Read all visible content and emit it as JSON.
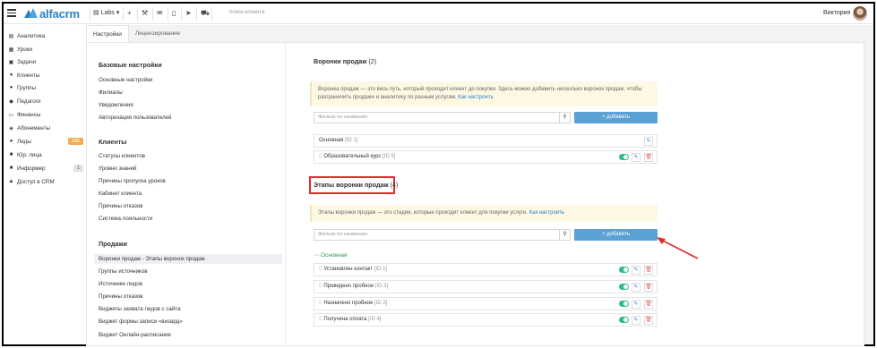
{
  "topbar": {
    "menu_icon": "hamburger-icon",
    "logo_text": "alfacrm",
    "workspace": "Labs",
    "workspace_icon": "building-icon",
    "icons": [
      "plus-icon",
      "wrench-icon",
      "mail-icon",
      "mobile-icon",
      "send-icon",
      "cart-icon"
    ],
    "search_placeholder": "поиск клиента",
    "user_name": "Виктория"
  },
  "sidebar": {
    "items": [
      {
        "label": "Аналитика",
        "icon": "chart-icon"
      },
      {
        "label": "Уроки",
        "icon": "calendar-icon"
      },
      {
        "label": "Задачи",
        "icon": "tasks-icon"
      },
      {
        "label": "Клиенты",
        "icon": "user-icon"
      },
      {
        "label": "Группы",
        "icon": "users-icon"
      },
      {
        "label": "Педагоги",
        "icon": "graduation-cap-icon"
      },
      {
        "label": "Финансы",
        "icon": "money-icon"
      },
      {
        "label": "Абонементы",
        "icon": "tag-icon"
      },
      {
        "label": "Лиды",
        "icon": "user-plus-icon",
        "badge": "335"
      },
      {
        "label": "Юр. лица",
        "icon": "briefcase-icon"
      },
      {
        "label": "Информер",
        "icon": "bell-icon",
        "badge": "1"
      },
      {
        "label": "Доступ в CRM",
        "icon": "lock-icon"
      }
    ]
  },
  "tabs": [
    {
      "label": "Настройки",
      "active": true
    },
    {
      "label": "Лицензирование",
      "active": false
    }
  ],
  "settings_nav": {
    "groups": [
      {
        "heading": "Базовые настройки",
        "links": [
          "Основные настройки",
          "Филиалы",
          "Уведомления",
          "Авторизация пользователей"
        ]
      },
      {
        "heading": "Клиенты",
        "links": [
          "Статусы клиентов",
          "Уровни знаний",
          "Причины пропуска уроков",
          "Кабинет клиента",
          "Причины отказов",
          "Система лояльности"
        ]
      },
      {
        "heading": "Продажи",
        "links": [
          "Воронки продаж - Этапы воронок продаж",
          "Группы источников",
          "Источники лидов",
          "Причины отказов",
          "Виджеты захвата лидов с сайта",
          "Виджет формы записи «визард»",
          "Виджет Онлайн-расписание"
        ],
        "active_index": 0
      }
    ]
  },
  "funnels": {
    "title": "Воронки продаж",
    "count": "(2)",
    "info_text": "Воронка продаж — это весь путь, который проходит клиент до покупки. Здесь можно добавить несколько воронок продаж, чтобы разграничить продажи и аналитику по разным услугам.",
    "info_link": "Как настроить",
    "filter_placeholder": "Фильтр по названию",
    "add_label": "+ добавить",
    "rows": [
      {
        "name": "Основная",
        "id": "[ID 1]",
        "toggle": false,
        "deletable": false
      },
      {
        "name": "Образовательный курс",
        "id": "[ID 5]",
        "toggle": true,
        "deletable": true
      }
    ]
  },
  "stages": {
    "title": "Этапы воронки продаж",
    "count": "(4)",
    "info_text": "Этапы воронки продаж — это стадии, которые проходит клиент для покупки услуги.",
    "info_link": "Как настроить",
    "filter_placeholder": "Фильтр по названию",
    "add_label": "+ добавить",
    "group_label": "Основная",
    "rows": [
      {
        "name": "Установлен контакт",
        "id": "[ID 1]"
      },
      {
        "name": "Проведено пробное",
        "id": "[ID 3]"
      },
      {
        "name": "Назначено пробное",
        "id": "[ID 2]"
      },
      {
        "name": "Получена оплата",
        "id": "[ID 4]"
      }
    ]
  },
  "colors": {
    "accent": "#2d7fc7",
    "add_button": "#5aa2d6",
    "toggle_on": "#2ebd8a",
    "highlight": "#d9302c",
    "badge_leads": "#f0ad4e"
  }
}
